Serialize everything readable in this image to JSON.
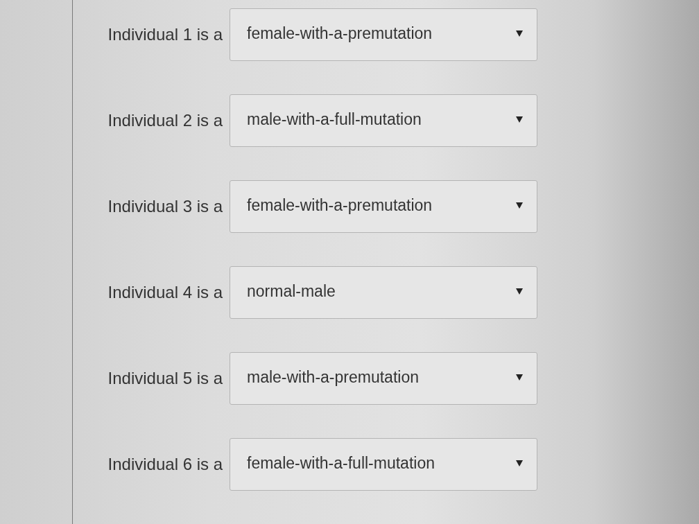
{
  "rows": [
    {
      "label": "Individual 1 is a",
      "value": "female-with-a-premutation"
    },
    {
      "label": "Individual 2 is a",
      "value": "male-with-a-full-mutation"
    },
    {
      "label": "Individual 3 is a",
      "value": "female-with-a-premutation"
    },
    {
      "label": "Individual 4 is a",
      "value": "normal-male"
    },
    {
      "label": "Individual 5 is a",
      "value": "male-with-a-premutation"
    },
    {
      "label": "Individual 6 is a",
      "value": "female-with-a-full-mutation"
    }
  ]
}
